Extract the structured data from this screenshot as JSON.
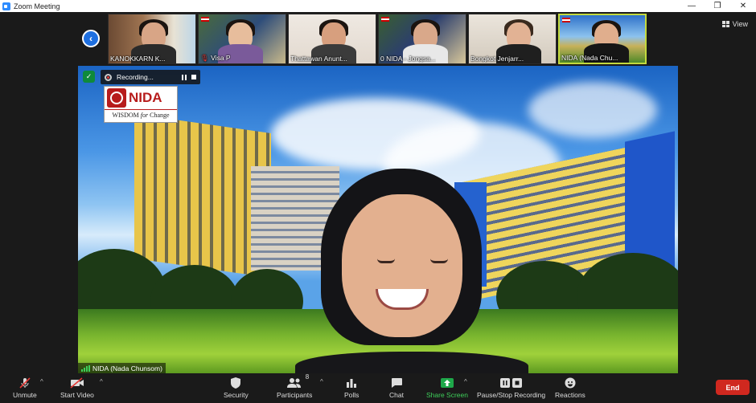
{
  "window": {
    "title": "Zoom Meeting",
    "minimize": "—",
    "restore": "❐",
    "close": "✕"
  },
  "gallery": {
    "prev_arrow": "‹",
    "view_label": "View",
    "participants": [
      {
        "name": "KANOKKARN K...",
        "muted": false
      },
      {
        "name": "Visa P",
        "muted": true
      },
      {
        "name": "Thattawan Anunt...",
        "muted": false
      },
      {
        "name": "0 NIDA - Jongsa...",
        "muted": false
      },
      {
        "name": "Bongkot Jenjarr...",
        "muted": false
      },
      {
        "name": "NIDA (Nada Chu...",
        "muted": false,
        "active": true
      }
    ]
  },
  "main_video": {
    "recording_label": "Recording...",
    "speaker_name": "NIDA (Nada Chunsom)",
    "logo": {
      "brand": "NIDA",
      "tagline_1": "WISDOM",
      "tagline_2": "for",
      "tagline_3": "Change"
    }
  },
  "toolbar": {
    "unmute": "Unmute",
    "start_video": "Start Video",
    "security": "Security",
    "participants": "Participants",
    "participants_count": "8",
    "polls": "Polls",
    "chat": "Chat",
    "share_screen": "Share Screen",
    "pause_stop_recording": "Pause/Stop Recording",
    "reactions": "Reactions",
    "end": "End"
  },
  "colors": {
    "accent_blue": "#1e6fe0",
    "recording_red": "#e53935",
    "share_green": "#1ea84a",
    "end_red": "#d0281f",
    "active_speaker": "#c3d93d"
  }
}
